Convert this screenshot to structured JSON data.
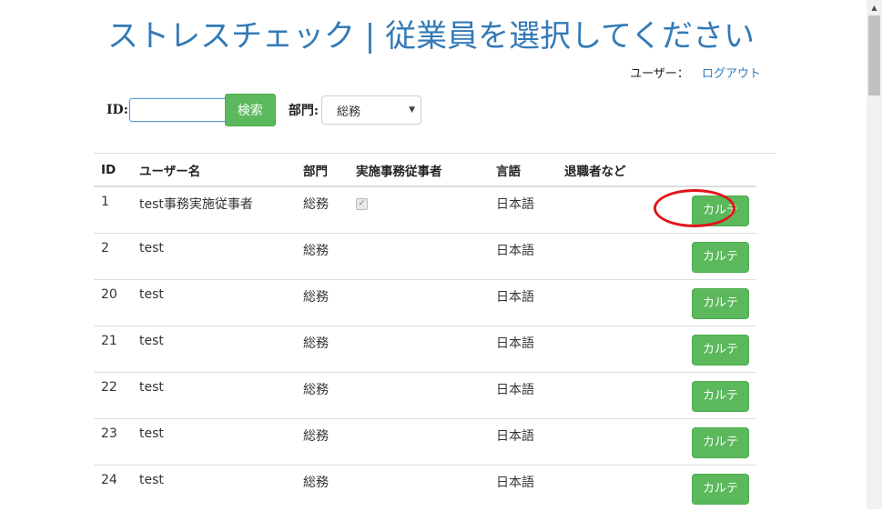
{
  "header": {
    "title": "ストレスチェック | 従業員を選択してください",
    "user_label": "ユーザー：",
    "logout_label": "ログアウト"
  },
  "search": {
    "id_label": "ID:",
    "id_value": "",
    "search_button": "検索",
    "dept_label": "部門:",
    "dept_selected": "総務"
  },
  "table": {
    "columns": [
      "ID",
      "ユーザー名",
      "部門",
      "実施事務従事者",
      "言語",
      "退職者など",
      ""
    ],
    "rows": [
      {
        "id": "1",
        "name": "test事務実施従事者",
        "dept": "総務",
        "staff": true,
        "lang": "日本語",
        "action": "カルテ"
      },
      {
        "id": "2",
        "name": "test",
        "dept": "総務",
        "staff": false,
        "lang": "日本語",
        "action": "カルテ"
      },
      {
        "id": "20",
        "name": "test",
        "dept": "総務",
        "staff": false,
        "lang": "日本語",
        "action": "カルテ"
      },
      {
        "id": "21",
        "name": "test",
        "dept": "総務",
        "staff": false,
        "lang": "日本語",
        "action": "カルテ"
      },
      {
        "id": "22",
        "name": "test",
        "dept": "総務",
        "staff": false,
        "lang": "日本語",
        "action": "カルテ"
      },
      {
        "id": "23",
        "name": "test",
        "dept": "総務",
        "staff": false,
        "lang": "日本語",
        "action": "カルテ"
      },
      {
        "id": "24",
        "name": "test",
        "dept": "総務",
        "staff": false,
        "lang": "日本語",
        "action": "カルテ"
      }
    ]
  },
  "colors": {
    "title": "#337ab7",
    "button": "#5cb85c",
    "highlight": "#e0161a"
  }
}
